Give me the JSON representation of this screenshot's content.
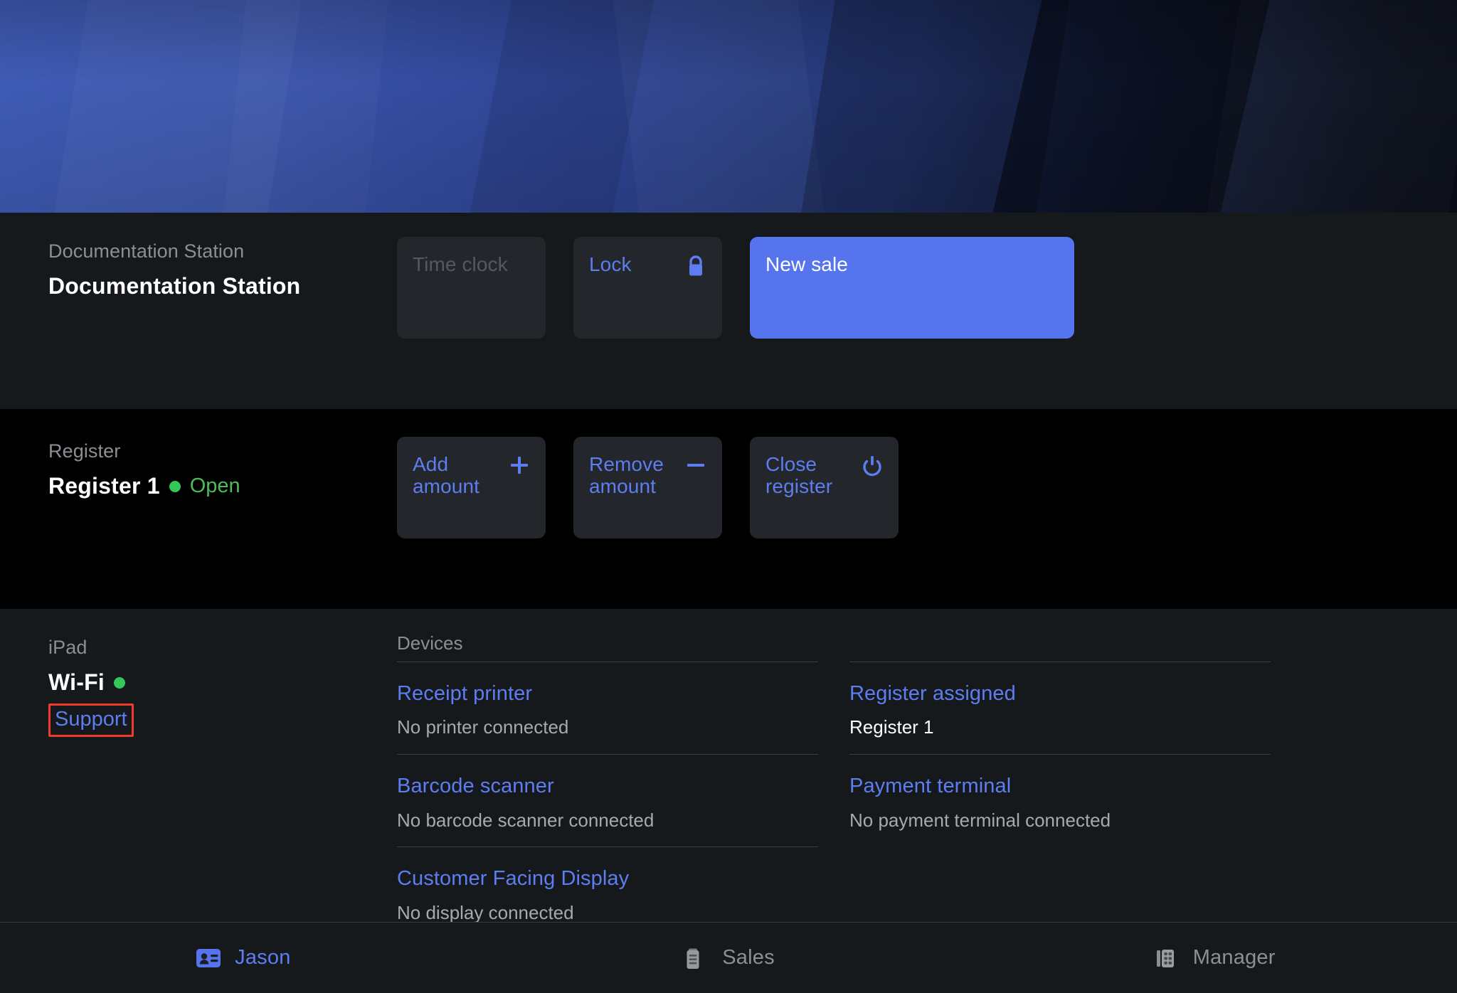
{
  "hero": {
    "alt": "blue-chevron-banner"
  },
  "station": {
    "label": "Documentation Station",
    "name": "Documentation Station",
    "actions": [
      {
        "label": "Time clock",
        "icon": "none",
        "state": "disabled"
      },
      {
        "label": "Lock",
        "icon": "lock-icon",
        "state": "enabled"
      },
      {
        "label": "New sale",
        "icon": "none",
        "state": "primary"
      }
    ]
  },
  "register": {
    "label": "Register",
    "name": "Register 1",
    "status": "Open",
    "status_color": "#4cbb5b",
    "actions": [
      {
        "label": "Add amount",
        "icon": "plus-icon"
      },
      {
        "label": "Remove amount",
        "icon": "minus-icon"
      },
      {
        "label": "Close register",
        "icon": "power-icon"
      }
    ]
  },
  "device_info": {
    "label": "iPad",
    "wifi_label": "Wi-Fi",
    "wifi_status_color": "#34c759",
    "support_label": "Support"
  },
  "devices": {
    "header": "Devices",
    "left": [
      {
        "name": "Receipt printer",
        "status": "No printer connected"
      },
      {
        "name": "Barcode scanner",
        "status": "No barcode scanner connected"
      },
      {
        "name": "Customer Facing Display",
        "status": "No display connected"
      }
    ],
    "right": [
      {
        "name": "Register assigned",
        "status": "Register 1",
        "strong": true
      },
      {
        "name": "Payment terminal",
        "status": "No payment terminal connected"
      }
    ]
  },
  "tabs": [
    {
      "label": "Jason",
      "icon": "id-badge-icon",
      "active": true
    },
    {
      "label": "Sales",
      "icon": "clipboard-icon",
      "active": false
    },
    {
      "label": "Manager",
      "icon": "building-grid-icon",
      "active": false
    }
  ],
  "colors": {
    "accent": "#5d7df0",
    "primary_button": "#5574ee",
    "status_green": "#34c759",
    "annotation_red": "#ef3b2d",
    "card_bg": "#23262a",
    "section_bg": "#16191c",
    "register_bg": "#000000"
  }
}
